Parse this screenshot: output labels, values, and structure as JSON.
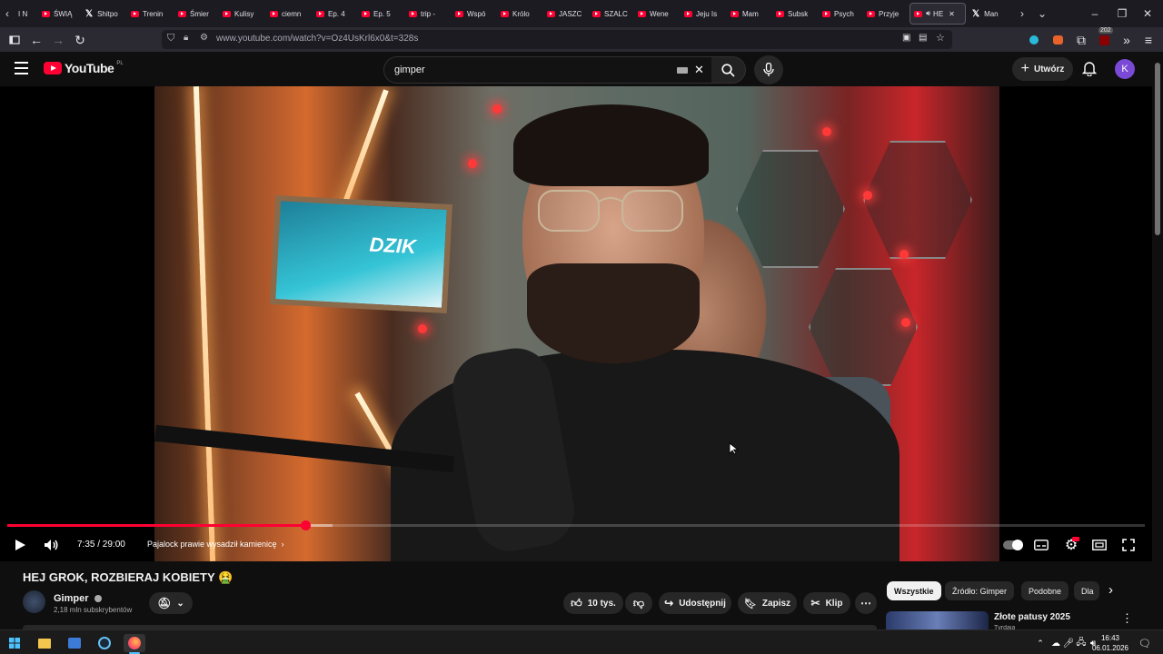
{
  "browser": {
    "tabs": [
      {
        "label": "I N",
        "kind": "none"
      },
      {
        "label": "ŚWIĄ",
        "kind": "yt"
      },
      {
        "label": "Shitpo",
        "kind": "x"
      },
      {
        "label": "Trenin",
        "kind": "yt"
      },
      {
        "label": "Śmier",
        "kind": "yt"
      },
      {
        "label": "Kulisy",
        "kind": "yt"
      },
      {
        "label": "ciemn",
        "kind": "yt"
      },
      {
        "label": "Ep. 4",
        "kind": "yt"
      },
      {
        "label": "Ep. 5",
        "kind": "yt"
      },
      {
        "label": "trip -",
        "kind": "yt"
      },
      {
        "label": "Wspó",
        "kind": "yt"
      },
      {
        "label": "Królo",
        "kind": "yt"
      },
      {
        "label": "JASZC",
        "kind": "yt"
      },
      {
        "label": "SZALC",
        "kind": "yt"
      },
      {
        "label": "Wene",
        "kind": "yt"
      },
      {
        "label": "Jeju Is",
        "kind": "yt"
      },
      {
        "label": "Mam",
        "kind": "yt"
      },
      {
        "label": "Subsk",
        "kind": "yt"
      },
      {
        "label": "Psych",
        "kind": "yt"
      },
      {
        "label": "Przyje",
        "kind": "yt"
      },
      {
        "label": "HE",
        "kind": "yt-active"
      },
      {
        "label": "Man",
        "kind": "x"
      }
    ],
    "url": "www.youtube.com/watch?v=Oz4UsKrl6x0&t=328s",
    "badge_count": "202"
  },
  "youtube": {
    "logo_text": "YouTube",
    "region": "PL",
    "search_value": "gimper",
    "create_label": "Utwórz",
    "avatar_letter": "K"
  },
  "player": {
    "current_time": "7:35",
    "duration": "29:00",
    "time_display": "7:35 / 29:00",
    "chapter": "Pajalock prawie wysadził kamienicę",
    "played_fraction": 0.262,
    "buffered_fraction": 0.286,
    "sign_text": "DZIK"
  },
  "video": {
    "title": "HEJ GROK, ROZBIERAJ KOBIETY 🤮",
    "channel": "Gimper",
    "subscribers": "2,18 mln subskrybentów",
    "like_count": "10 tys.",
    "share_label": "Udostępnij",
    "save_label": "Zapisz",
    "clip_label": "Klip"
  },
  "sidebar": {
    "chips": [
      "Wszystkie",
      "Źródło: Gimper",
      "Podobne",
      "Dla"
    ],
    "first_video_title": "Złote patusy 2025",
    "first_video_channel": "Tvrdaia"
  },
  "taskbar": {
    "time": "16:43",
    "date": "06.01.2026"
  },
  "colors": {
    "yt_red": "#ff0033",
    "background": "#0f0f0f",
    "avatar": "#7a4ad6"
  }
}
